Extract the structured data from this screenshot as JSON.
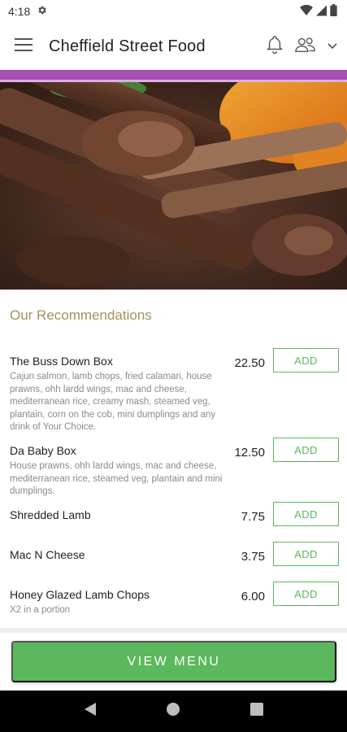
{
  "status_bar": {
    "time": "4:18"
  },
  "app_bar": {
    "title": "Cheffield Street Food"
  },
  "colors": {
    "accent": "#a84fb3",
    "green": "#5cb85c",
    "section_title": "#a3925e"
  },
  "section": {
    "title": "Our Recommendations"
  },
  "menu": {
    "add_label": "ADD",
    "items": [
      {
        "name": "The Buss Down Box",
        "description": "Cajun salmon, lamb chops, fried calamari, house prawns, ohh lardd wings, mac and cheese, mediterranean rice, creamy mash, steamed veg, plantain, corn on the cob, mini dumplings and any drink of Your Choice.",
        "price": "22.50"
      },
      {
        "name": "Da Baby Box",
        "description": "House prawns, ohh lardd wings, mac and cheese, mediterranean rice, steamed veg, plantain and mini dumplings.",
        "price": "12.50"
      },
      {
        "name": "Shredded Lamb",
        "description": "",
        "price": "7.75"
      },
      {
        "name": "Mac N Cheese",
        "description": "",
        "price": "3.75"
      },
      {
        "name": "Honey Glazed Lamb Chops",
        "description": "X2 in a portion",
        "price": "6.00"
      }
    ]
  },
  "footer": {
    "view_menu_label": "VIEW MENU"
  }
}
